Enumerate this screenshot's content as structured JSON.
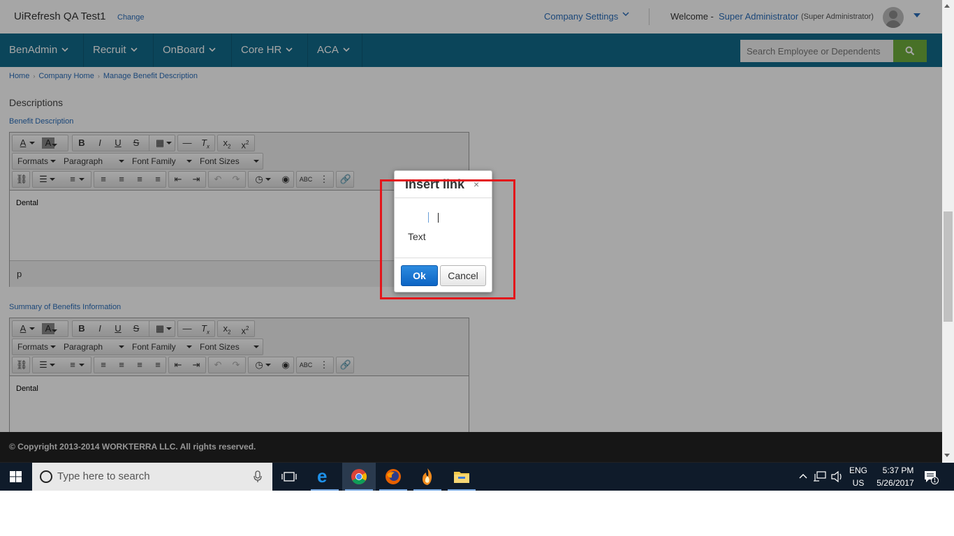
{
  "header": {
    "app_title": "UiRefresh QA Test1",
    "change_label": "Change",
    "company_settings_label": "Company Settings",
    "welcome_label": "Welcome -",
    "user_name": "Super Administrator",
    "user_role": "(Super Administrator)"
  },
  "nav": {
    "items": [
      {
        "label": "BenAdmin"
      },
      {
        "label": "Recruit"
      },
      {
        "label": "OnBoard"
      },
      {
        "label": "Core HR"
      },
      {
        "label": "ACA"
      }
    ],
    "search_placeholder": "Search Employee or Dependents"
  },
  "breadcrumb": {
    "items": [
      "Home",
      "Company Home",
      "Manage Benefit Description"
    ]
  },
  "page": {
    "section_title": "Descriptions",
    "benefit_description_label": "Benefit Description",
    "summary_label": "Summary of Benefits Information"
  },
  "editor": {
    "formats_label": "Formats",
    "paragraph_label": "Paragraph",
    "font_family_label": "Font Family",
    "font_sizes_label": "Font Sizes",
    "benefit_content": "Dental",
    "benefit_status_path": "p",
    "summary_content": "Dental"
  },
  "modal": {
    "title": "Insert link",
    "close_glyph": "×",
    "text_label": "Text",
    "ok_label": "Ok",
    "cancel_label": "Cancel"
  },
  "footer": {
    "copyright": "© Copyright 2013-2014 WORKTERRA LLC. All rights reserved."
  },
  "taskbar": {
    "search_placeholder": "Type here to search",
    "lang_top": "ENG",
    "lang_bottom": "US",
    "time": "5:37 PM",
    "date": "5/26/2017",
    "notification_count": "1"
  },
  "colors": {
    "nav_bg": "#126b8a",
    "link": "#2a6ebb",
    "search_button": "#6fae3d",
    "ok_button": "#0c64c4",
    "highlight": "#e3161b"
  }
}
